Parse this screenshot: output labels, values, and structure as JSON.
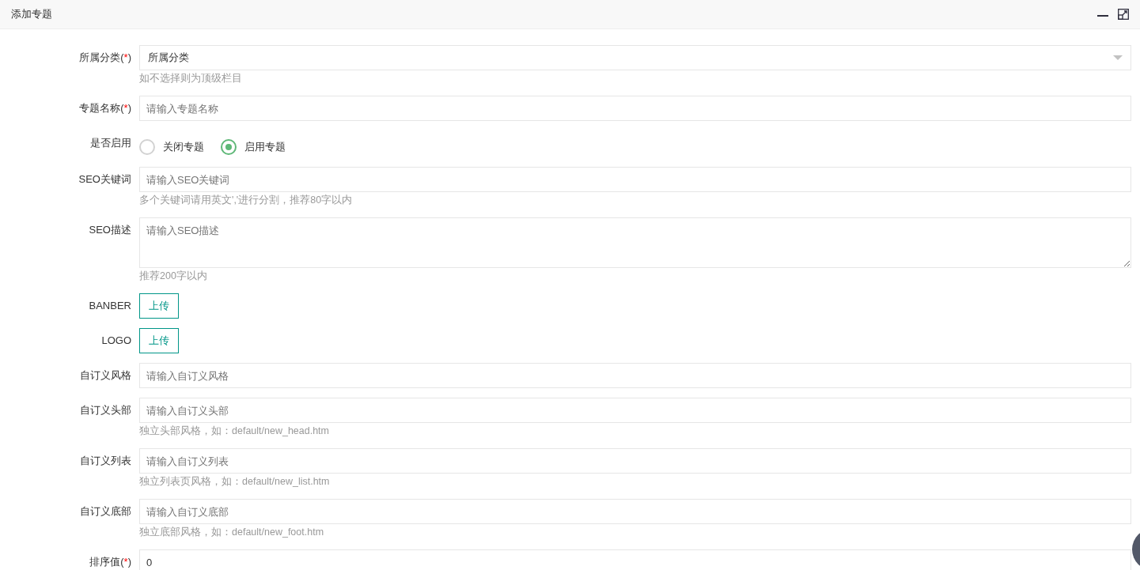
{
  "window": {
    "title": "添加专题"
  },
  "fields": [
    {
      "kind": "select",
      "label": "所属分类",
      "required_mark": "(*)",
      "value": "所属分类",
      "hint": "如不选择则为顶级栏目"
    },
    {
      "kind": "text",
      "label": "专题名称",
      "required_mark": "(*)",
      "placeholder": "请输入专题名称"
    },
    {
      "kind": "radio",
      "label": "是否启用",
      "options": [
        {
          "label": "关闭专题",
          "selected": false
        },
        {
          "label": "启用专题",
          "selected": true
        }
      ]
    },
    {
      "kind": "text",
      "label": "SEO关键词",
      "placeholder": "请输入SEO关键词",
      "hint": "多个关键词请用英文','进行分割，推荐80字以内"
    },
    {
      "kind": "textarea",
      "label": "SEO描述",
      "placeholder": "请输入SEO描述",
      "hint": "推荐200字以内"
    },
    {
      "kind": "upload",
      "label": "BANBER",
      "button": "上传"
    },
    {
      "kind": "upload",
      "label": "LOGO",
      "button": "上传"
    },
    {
      "kind": "text",
      "label": "自订义风格",
      "placeholder": "请输入自订义风格"
    },
    {
      "kind": "text",
      "label": "自订义头部",
      "placeholder": "请输入自订义头部",
      "hint": "独立头部风格，如：default/new_head.htm"
    },
    {
      "kind": "text",
      "label": "自订义列表",
      "placeholder": "请输入自订义列表",
      "hint": "独立列表页风格，如：default/new_list.htm"
    },
    {
      "kind": "text",
      "label": "自订义底部",
      "placeholder": "请输入自订义底部",
      "hint": "独立底部风格，如：default/new_foot.htm"
    },
    {
      "kind": "text",
      "label": "排序值",
      "required_mark": "(*)",
      "value": "0"
    }
  ]
}
